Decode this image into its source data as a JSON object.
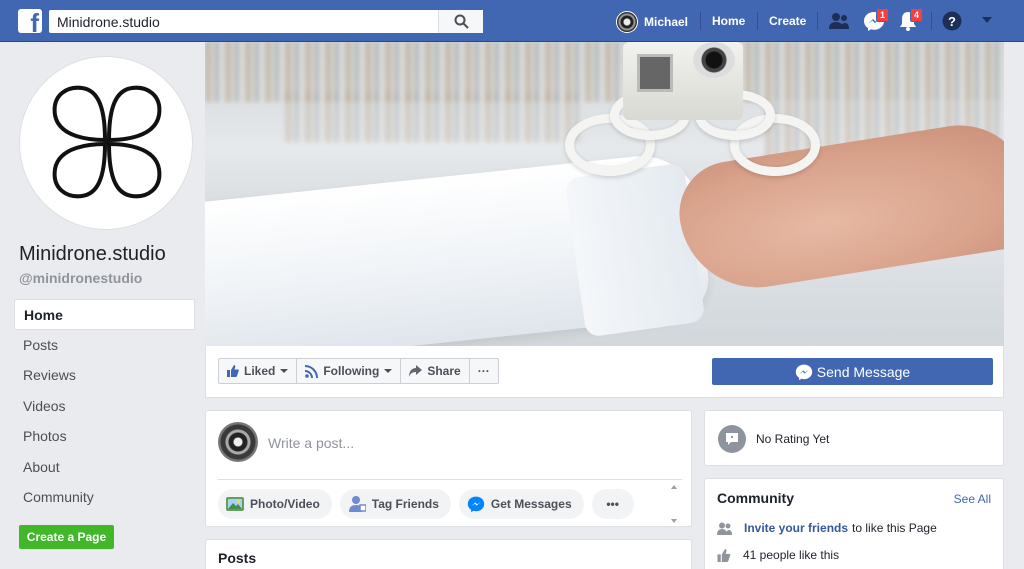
{
  "topbar": {
    "logo": "f",
    "search_value": "Minidrone.studio",
    "user_name": "Michael",
    "home_label": "Home",
    "create_label": "Create",
    "messages_badge": "1",
    "notifications_badge": "4"
  },
  "page": {
    "name": "Minidrone.studio",
    "handle": "@minidronestudio"
  },
  "left_nav": {
    "items": [
      {
        "label": "Home"
      },
      {
        "label": "Posts"
      },
      {
        "label": "Reviews"
      },
      {
        "label": "Videos"
      },
      {
        "label": "Photos"
      },
      {
        "label": "About"
      },
      {
        "label": "Community"
      }
    ],
    "create_page_label": "Create a Page"
  },
  "actions": {
    "liked_label": "Liked",
    "following_label": "Following",
    "share_label": "Share",
    "more_label": "···",
    "send_message_label": "Send Message"
  },
  "composer": {
    "placeholder": "Write a post...",
    "photo_video": "Photo/Video",
    "tag_friends": "Tag Friends",
    "get_messages": "Get Messages",
    "more": "•••"
  },
  "posts": {
    "title": "Posts"
  },
  "rating": {
    "text": "No Rating Yet"
  },
  "community": {
    "title": "Community",
    "see_all": "See All",
    "invite_link": "Invite your friends",
    "invite_rest": "to like this Page",
    "likes_text": "41 people like this"
  },
  "colors": {
    "brand_blue": "#4267b2",
    "create_green": "#42b72a",
    "badge_red": "#fa3e3e"
  }
}
